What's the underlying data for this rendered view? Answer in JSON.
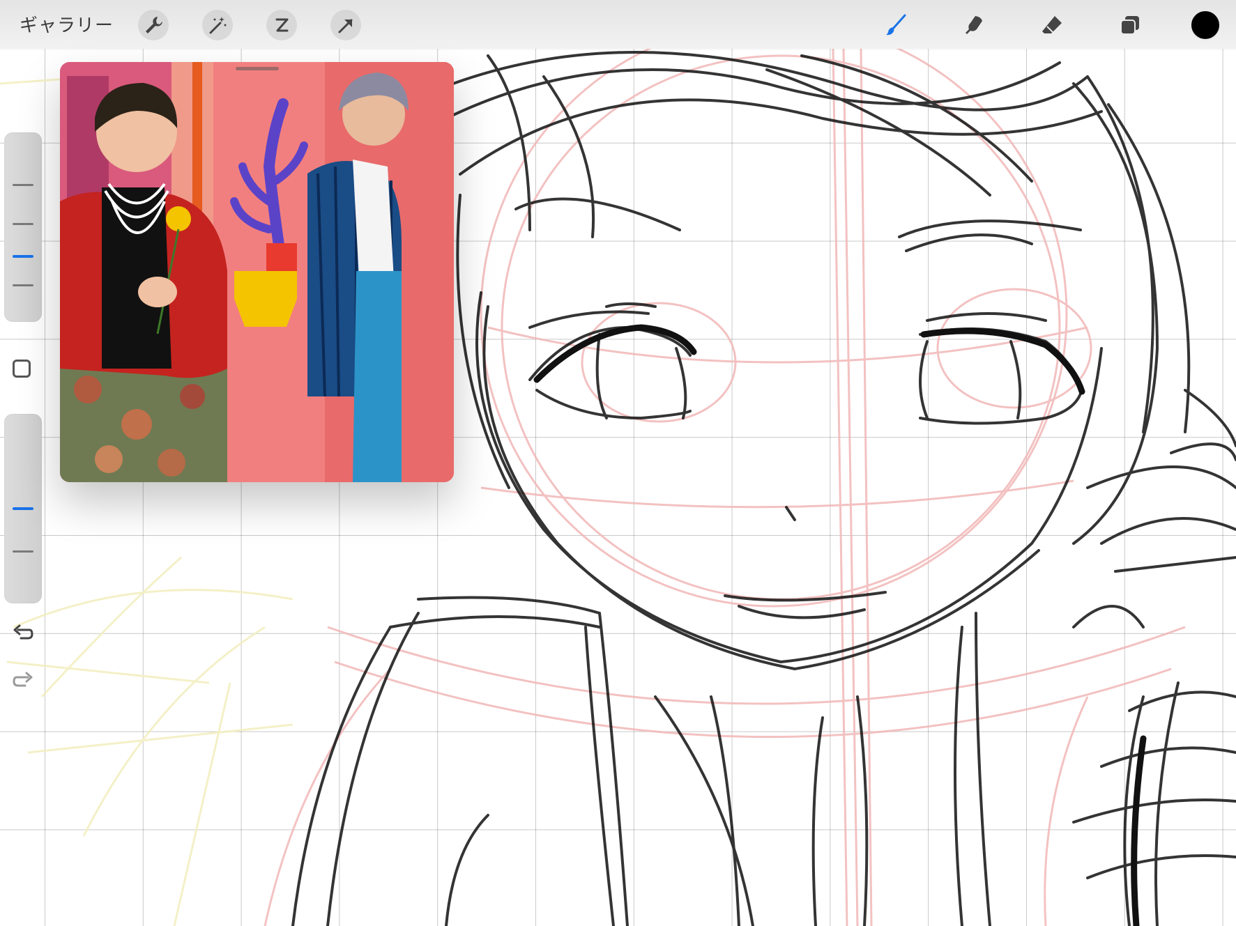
{
  "toolbar": {
    "gallery_label": "ギャラリー",
    "left_tools": [
      "wrench-icon",
      "magic-wand-icon",
      "selection-icon",
      "transform-arrow-icon"
    ],
    "right_tools": [
      "brush-icon",
      "smudge-icon",
      "eraser-icon",
      "layers-icon"
    ],
    "active_tool": "brush-icon",
    "current_color": "#000000",
    "accent_color": "#1a73e8"
  },
  "sidebar": {
    "brush_size_level": 0.3,
    "opacity_level": 0.5,
    "modify_icon": "square-icon",
    "undo_icon": "undo-icon",
    "redo_icon": "redo-icon"
  },
  "reference": {
    "subject": "two-people-photo",
    "colors": [
      "#e56a6a",
      "#c52a25",
      "#1d4f8a",
      "#f4c400",
      "#6a55c9"
    ]
  },
  "canvas": {
    "grid": true,
    "sketch_colors": [
      "#111111",
      "#f2b7b7",
      "#f3efc2"
    ]
  }
}
